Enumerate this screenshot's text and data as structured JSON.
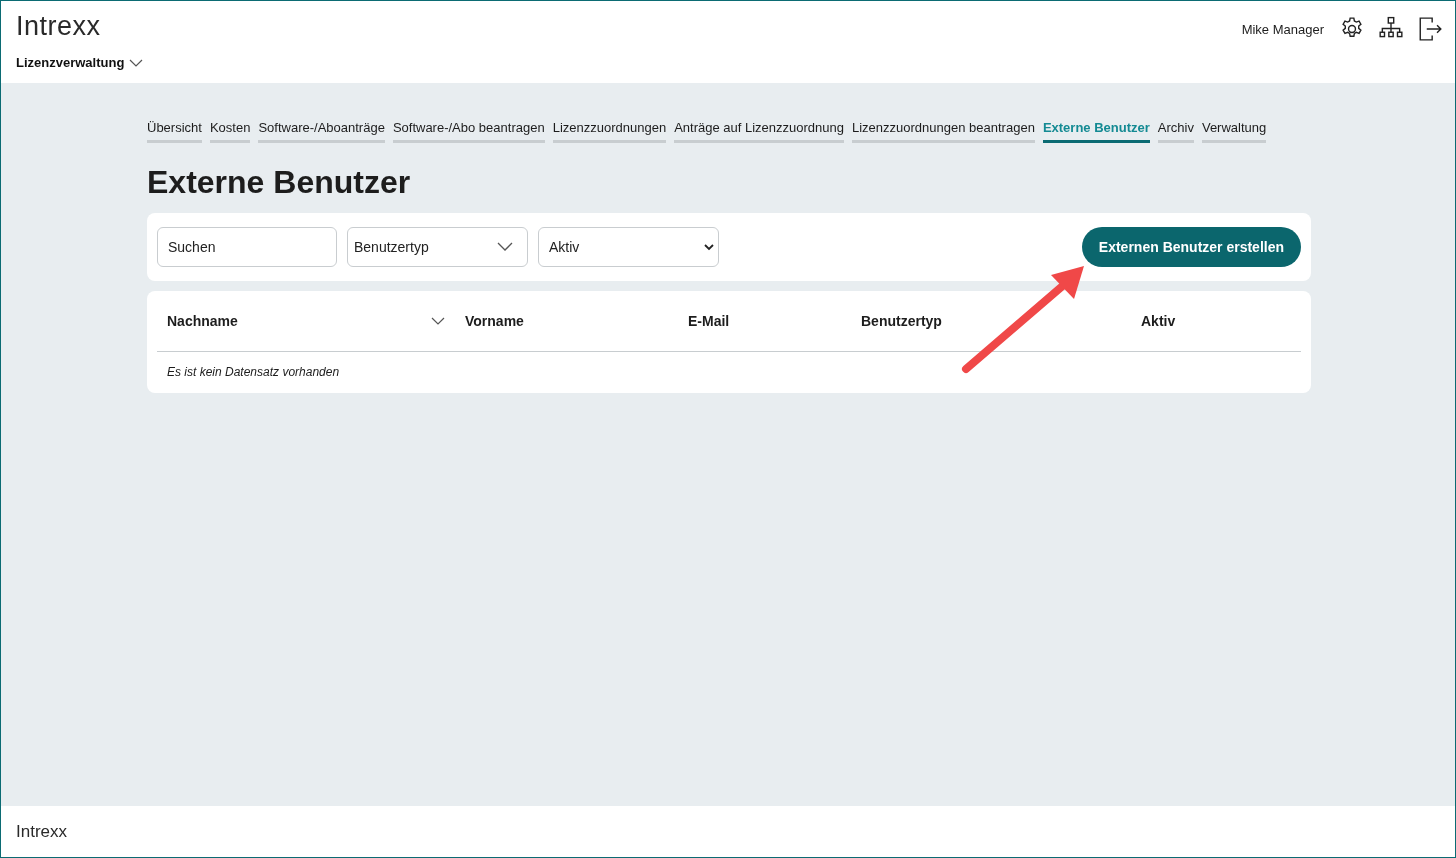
{
  "header": {
    "logo": "Intrexx",
    "app_menu": "Lizenzverwaltung",
    "user": "Mike Manager"
  },
  "tabs": [
    {
      "label": "Übersicht",
      "selected": false
    },
    {
      "label": "Kosten",
      "selected": false
    },
    {
      "label": "Software-/Aboanträge",
      "selected": false
    },
    {
      "label": "Software-/Abo beantragen",
      "selected": false
    },
    {
      "label": "Lizenzzuordnungen",
      "selected": false
    },
    {
      "label": "Anträge auf Lizenzzuordnung",
      "selected": false
    },
    {
      "label": "Lizenzzuordnungen beantragen",
      "selected": false
    },
    {
      "label": "Externe Benutzer",
      "selected": true
    },
    {
      "label": "Archiv",
      "selected": false
    },
    {
      "label": "Verwaltung",
      "selected": false
    }
  ],
  "page_title": "Externe Benutzer",
  "filters": {
    "search": {
      "placeholder": "Suchen"
    },
    "user_type": {
      "value": "Benutzertyp"
    },
    "active": {
      "value": "Aktiv"
    },
    "create_button": "Externen Benutzer erstellen"
  },
  "table": {
    "columns": [
      {
        "label": "Nachname",
        "sorted": true
      },
      {
        "label": "Vorname",
        "sorted": false
      },
      {
        "label": "E-Mail",
        "sorted": false
      },
      {
        "label": "Benutzertyp",
        "sorted": false
      },
      {
        "label": "Aktiv",
        "sorted": false
      }
    ],
    "empty_message": "Es ist kein Datensatz vorhanden"
  },
  "footer": {
    "logo": "Intrexx"
  }
}
